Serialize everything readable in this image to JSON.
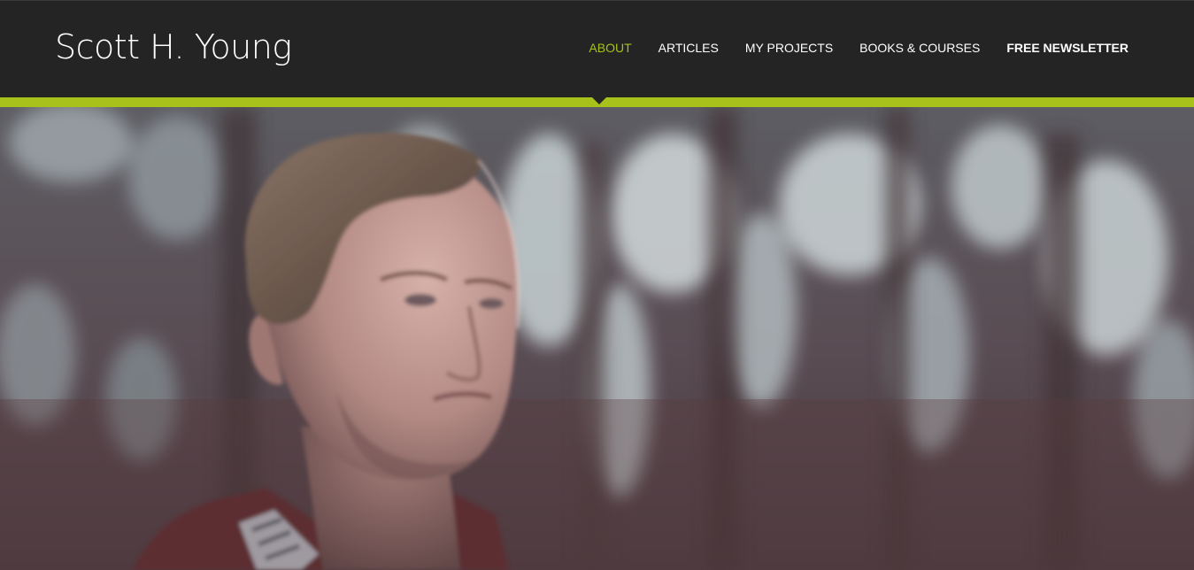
{
  "site": {
    "title": "Scott H. Young"
  },
  "nav": {
    "items": [
      {
        "label": "ABOUT",
        "active": true
      },
      {
        "label": "ARTICLES"
      },
      {
        "label": "MY PROJECTS"
      },
      {
        "label": "BOOKS & COURSES"
      },
      {
        "label": "FREE NEWSLETTER",
        "emphasis": true
      }
    ]
  },
  "colors": {
    "header_bg": "#242424",
    "accent": "#a8c11b",
    "nav_active": "#a6c21a",
    "nav_text": "#ffffff"
  },
  "hero": {
    "image_subject": "portrait-photo",
    "background": "bokeh-forest"
  }
}
